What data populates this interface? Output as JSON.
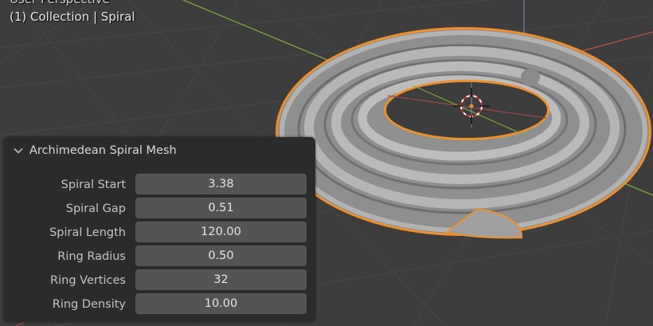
{
  "viewport": {
    "view_name": "User Perspective",
    "object_info": "(1) Collection | Spiral"
  },
  "operator_panel": {
    "title": "Archimedean Spiral Mesh",
    "fields": [
      {
        "label": "Spiral Start",
        "value": "3.38"
      },
      {
        "label": "Spiral Gap",
        "value": "0.51"
      },
      {
        "label": "Spiral Length",
        "value": "120.00"
      },
      {
        "label": "Ring Radius",
        "value": "0.50"
      },
      {
        "label": "Ring Vertices",
        "value": "32"
      },
      {
        "label": "Ring Density",
        "value": "10.00"
      }
    ]
  },
  "colors": {
    "background": "#3d3d3d",
    "grid": "#4a4a4a",
    "x_axis": "#c05050",
    "y_axis": "#7fa83a",
    "selection_outline": "#f0902a",
    "mesh": "#a3a3a3",
    "panel_bg": "#2b2b2b",
    "field_bg": "#545454"
  },
  "icons": {
    "collapse": "chevron-down-icon",
    "cursor": "3d-cursor-icon"
  }
}
